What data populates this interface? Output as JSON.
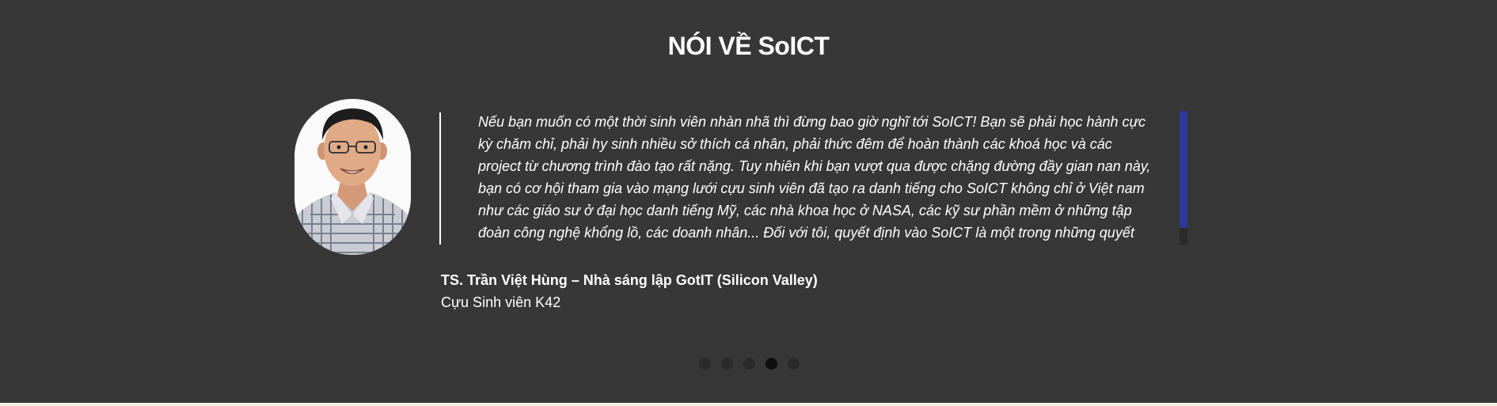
{
  "section": {
    "title": "NÓI VỀ SoICT"
  },
  "testimonial": {
    "quote": "Nếu bạn muốn có một thời sinh viên nhàn nhã thì đừng bao giờ nghĩ tới SoICT! Bạn sẽ phải học hành cực kỳ chăm chỉ, phải hy sinh nhiều sở thích cá nhân, phải thức đêm để hoàn thành các khoá học và các project từ chương trình đào tạo rất nặng. Tuy nhiên khi bạn vượt qua được chặng đường đầy gian nan này, bạn có cơ hội tham gia vào mạng lưới cựu sinh viên đã tạo ra danh tiếng cho SoICT không chỉ ở Việt nam như các giáo sư ở đại học danh tiếng Mỹ, các nhà khoa học ở NASA, các kỹ sư phần mềm ở những tập đoàn công nghệ khổng lồ, các doanh nhân... Đối với tôi, quyết định vào SoICT là một trong những quyết định quan trọng nhất",
    "author_name": "TS. Trần Việt Hùng – Nhà sáng lập GotIT (Silicon Valley)",
    "author_role": "Cựu Sinh viên K42"
  },
  "carousel": {
    "dot_count": 5,
    "active_index": 3
  },
  "colors": {
    "background": "#373737",
    "text": "#ffffff",
    "scroll_thumb": "#2d3a9a",
    "dot": "#2a2a2a",
    "dot_active": "#0f0f0f"
  }
}
